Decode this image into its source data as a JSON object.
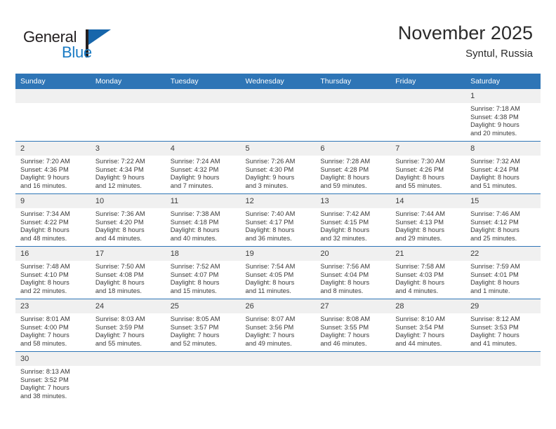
{
  "brand": {
    "name_top": "General",
    "name_bottom": "Blue",
    "flag_icon": "blue-flag-triangle-icon",
    "accent_color": "#1766ab",
    "text_color": "#231f20"
  },
  "header": {
    "title": "November 2025",
    "location": "Syntul, Russia"
  },
  "theme": {
    "header_bg": "#2e75b6",
    "header_text": "#ffffff",
    "daynum_bg": "#f0f0f0",
    "row_divider": "#2e75b6",
    "body_text": "#3a3a3a"
  },
  "weekday_headers": [
    "Sunday",
    "Monday",
    "Tuesday",
    "Wednesday",
    "Thursday",
    "Friday",
    "Saturday"
  ],
  "weeks": [
    [
      {
        "day": "",
        "blank": true
      },
      {
        "day": "",
        "blank": true
      },
      {
        "day": "",
        "blank": true
      },
      {
        "day": "",
        "blank": true
      },
      {
        "day": "",
        "blank": true
      },
      {
        "day": "",
        "blank": true
      },
      {
        "day": "1",
        "sunrise": "Sunrise: 7:18 AM",
        "sunset": "Sunset: 4:38 PM",
        "daylight_line1": "Daylight: 9 hours",
        "daylight_line2": "and 20 minutes."
      }
    ],
    [
      {
        "day": "2",
        "sunrise": "Sunrise: 7:20 AM",
        "sunset": "Sunset: 4:36 PM",
        "daylight_line1": "Daylight: 9 hours",
        "daylight_line2": "and 16 minutes."
      },
      {
        "day": "3",
        "sunrise": "Sunrise: 7:22 AM",
        "sunset": "Sunset: 4:34 PM",
        "daylight_line1": "Daylight: 9 hours",
        "daylight_line2": "and 12 minutes."
      },
      {
        "day": "4",
        "sunrise": "Sunrise: 7:24 AM",
        "sunset": "Sunset: 4:32 PM",
        "daylight_line1": "Daylight: 9 hours",
        "daylight_line2": "and 7 minutes."
      },
      {
        "day": "5",
        "sunrise": "Sunrise: 7:26 AM",
        "sunset": "Sunset: 4:30 PM",
        "daylight_line1": "Daylight: 9 hours",
        "daylight_line2": "and 3 minutes."
      },
      {
        "day": "6",
        "sunrise": "Sunrise: 7:28 AM",
        "sunset": "Sunset: 4:28 PM",
        "daylight_line1": "Daylight: 8 hours",
        "daylight_line2": "and 59 minutes."
      },
      {
        "day": "7",
        "sunrise": "Sunrise: 7:30 AM",
        "sunset": "Sunset: 4:26 PM",
        "daylight_line1": "Daylight: 8 hours",
        "daylight_line2": "and 55 minutes."
      },
      {
        "day": "8",
        "sunrise": "Sunrise: 7:32 AM",
        "sunset": "Sunset: 4:24 PM",
        "daylight_line1": "Daylight: 8 hours",
        "daylight_line2": "and 51 minutes."
      }
    ],
    [
      {
        "day": "9",
        "sunrise": "Sunrise: 7:34 AM",
        "sunset": "Sunset: 4:22 PM",
        "daylight_line1": "Daylight: 8 hours",
        "daylight_line2": "and 48 minutes."
      },
      {
        "day": "10",
        "sunrise": "Sunrise: 7:36 AM",
        "sunset": "Sunset: 4:20 PM",
        "daylight_line1": "Daylight: 8 hours",
        "daylight_line2": "and 44 minutes."
      },
      {
        "day": "11",
        "sunrise": "Sunrise: 7:38 AM",
        "sunset": "Sunset: 4:18 PM",
        "daylight_line1": "Daylight: 8 hours",
        "daylight_line2": "and 40 minutes."
      },
      {
        "day": "12",
        "sunrise": "Sunrise: 7:40 AM",
        "sunset": "Sunset: 4:17 PM",
        "daylight_line1": "Daylight: 8 hours",
        "daylight_line2": "and 36 minutes."
      },
      {
        "day": "13",
        "sunrise": "Sunrise: 7:42 AM",
        "sunset": "Sunset: 4:15 PM",
        "daylight_line1": "Daylight: 8 hours",
        "daylight_line2": "and 32 minutes."
      },
      {
        "day": "14",
        "sunrise": "Sunrise: 7:44 AM",
        "sunset": "Sunset: 4:13 PM",
        "daylight_line1": "Daylight: 8 hours",
        "daylight_line2": "and 29 minutes."
      },
      {
        "day": "15",
        "sunrise": "Sunrise: 7:46 AM",
        "sunset": "Sunset: 4:12 PM",
        "daylight_line1": "Daylight: 8 hours",
        "daylight_line2": "and 25 minutes."
      }
    ],
    [
      {
        "day": "16",
        "sunrise": "Sunrise: 7:48 AM",
        "sunset": "Sunset: 4:10 PM",
        "daylight_line1": "Daylight: 8 hours",
        "daylight_line2": "and 22 minutes."
      },
      {
        "day": "17",
        "sunrise": "Sunrise: 7:50 AM",
        "sunset": "Sunset: 4:08 PM",
        "daylight_line1": "Daylight: 8 hours",
        "daylight_line2": "and 18 minutes."
      },
      {
        "day": "18",
        "sunrise": "Sunrise: 7:52 AM",
        "sunset": "Sunset: 4:07 PM",
        "daylight_line1": "Daylight: 8 hours",
        "daylight_line2": "and 15 minutes."
      },
      {
        "day": "19",
        "sunrise": "Sunrise: 7:54 AM",
        "sunset": "Sunset: 4:05 PM",
        "daylight_line1": "Daylight: 8 hours",
        "daylight_line2": "and 11 minutes."
      },
      {
        "day": "20",
        "sunrise": "Sunrise: 7:56 AM",
        "sunset": "Sunset: 4:04 PM",
        "daylight_line1": "Daylight: 8 hours",
        "daylight_line2": "and 8 minutes."
      },
      {
        "day": "21",
        "sunrise": "Sunrise: 7:58 AM",
        "sunset": "Sunset: 4:03 PM",
        "daylight_line1": "Daylight: 8 hours",
        "daylight_line2": "and 4 minutes."
      },
      {
        "day": "22",
        "sunrise": "Sunrise: 7:59 AM",
        "sunset": "Sunset: 4:01 PM",
        "daylight_line1": "Daylight: 8 hours",
        "daylight_line2": "and 1 minute."
      }
    ],
    [
      {
        "day": "23",
        "sunrise": "Sunrise: 8:01 AM",
        "sunset": "Sunset: 4:00 PM",
        "daylight_line1": "Daylight: 7 hours",
        "daylight_line2": "and 58 minutes."
      },
      {
        "day": "24",
        "sunrise": "Sunrise: 8:03 AM",
        "sunset": "Sunset: 3:59 PM",
        "daylight_line1": "Daylight: 7 hours",
        "daylight_line2": "and 55 minutes."
      },
      {
        "day": "25",
        "sunrise": "Sunrise: 8:05 AM",
        "sunset": "Sunset: 3:57 PM",
        "daylight_line1": "Daylight: 7 hours",
        "daylight_line2": "and 52 minutes."
      },
      {
        "day": "26",
        "sunrise": "Sunrise: 8:07 AM",
        "sunset": "Sunset: 3:56 PM",
        "daylight_line1": "Daylight: 7 hours",
        "daylight_line2": "and 49 minutes."
      },
      {
        "day": "27",
        "sunrise": "Sunrise: 8:08 AM",
        "sunset": "Sunset: 3:55 PM",
        "daylight_line1": "Daylight: 7 hours",
        "daylight_line2": "and 46 minutes."
      },
      {
        "day": "28",
        "sunrise": "Sunrise: 8:10 AM",
        "sunset": "Sunset: 3:54 PM",
        "daylight_line1": "Daylight: 7 hours",
        "daylight_line2": "and 44 minutes."
      },
      {
        "day": "29",
        "sunrise": "Sunrise: 8:12 AM",
        "sunset": "Sunset: 3:53 PM",
        "daylight_line1": "Daylight: 7 hours",
        "daylight_line2": "and 41 minutes."
      }
    ],
    [
      {
        "day": "30",
        "sunrise": "Sunrise: 8:13 AM",
        "sunset": "Sunset: 3:52 PM",
        "daylight_line1": "Daylight: 7 hours",
        "daylight_line2": "and 38 minutes."
      },
      {
        "day": "",
        "blank": true
      },
      {
        "day": "",
        "blank": true
      },
      {
        "day": "",
        "blank": true
      },
      {
        "day": "",
        "blank": true
      },
      {
        "day": "",
        "blank": true
      },
      {
        "day": "",
        "blank": true
      }
    ]
  ]
}
